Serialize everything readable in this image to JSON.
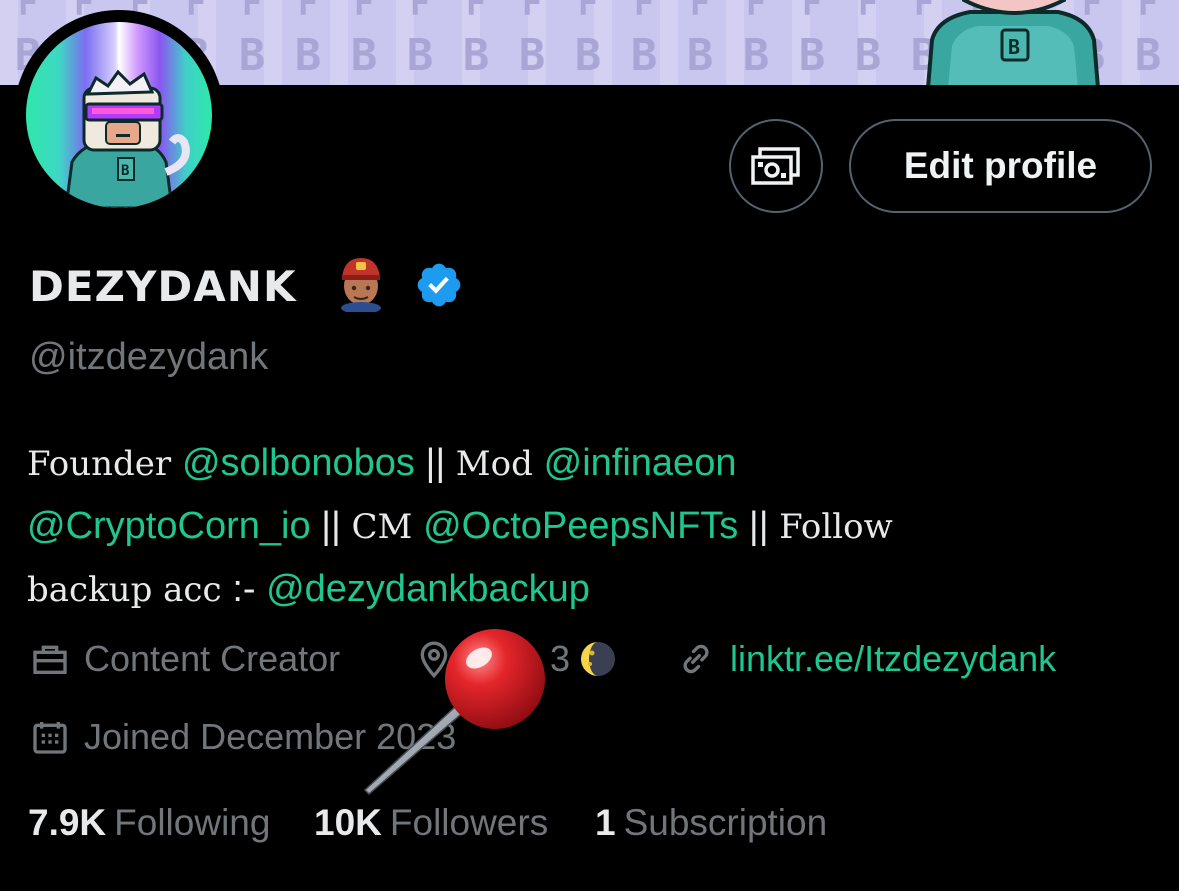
{
  "banner": {
    "top_row_glyph": "F",
    "bottom_row_glyph": "B",
    "background_color": "#c9c6ef"
  },
  "profile": {
    "avatar_icon": "pixel-monkey-avatar",
    "display_name": "DEZYDANK",
    "name_emoji_icon": "person-with-cap-emoji",
    "verified_icon": "verified-badge-icon",
    "handle": "@itzdezydank"
  },
  "actions": {
    "money_icon": "money-icon",
    "edit_profile_label": "Edit profile"
  },
  "bio": {
    "line1": [
      {
        "type": "text",
        "value": "Founder "
      },
      {
        "type": "link",
        "value": "@solbonobos"
      },
      {
        "type": "sep",
        "value": " || "
      },
      {
        "type": "text",
        "value": "Mod "
      },
      {
        "type": "link",
        "value": "@infinaeon"
      }
    ],
    "line2": [
      {
        "type": "link",
        "value": "@CryptoCorn_io"
      },
      {
        "type": "sep",
        "value": " || "
      },
      {
        "type": "text",
        "value": "CM "
      },
      {
        "type": "link",
        "value": "@OctoPeepsNFTs"
      },
      {
        "type": "sep",
        "value": " || "
      },
      {
        "type": "text",
        "value": "Follow"
      }
    ],
    "line3": [
      {
        "type": "text",
        "value": "backup acc "
      },
      {
        "type": "sep",
        "value": ":- "
      },
      {
        "type": "link",
        "value": "@dezydankbackup"
      }
    ]
  },
  "meta": {
    "category_icon": "briefcase-icon",
    "category": "Content Creator",
    "location_icon": "location-pin-icon",
    "location_visible_text": "3",
    "location_emoji": "waxing-moon-emoji",
    "website_icon": "link-icon",
    "website": "linktr.ee/Itzdezydank",
    "joined_icon": "calendar-icon",
    "joined": "Joined December 2023"
  },
  "stats": {
    "following_count": "7.9K",
    "following_label": "Following",
    "followers_count": "10K",
    "followers_label": "Followers",
    "subscriptions_count": "1",
    "subscriptions_label": "Subscription"
  },
  "overlay": {
    "pin_icon": "red-pushpin-icon"
  },
  "colors": {
    "link": "#1fc68f",
    "muted": "#71767b",
    "text": "#e7e9ea",
    "verified": "#1d9bf0",
    "border": "#536471"
  }
}
